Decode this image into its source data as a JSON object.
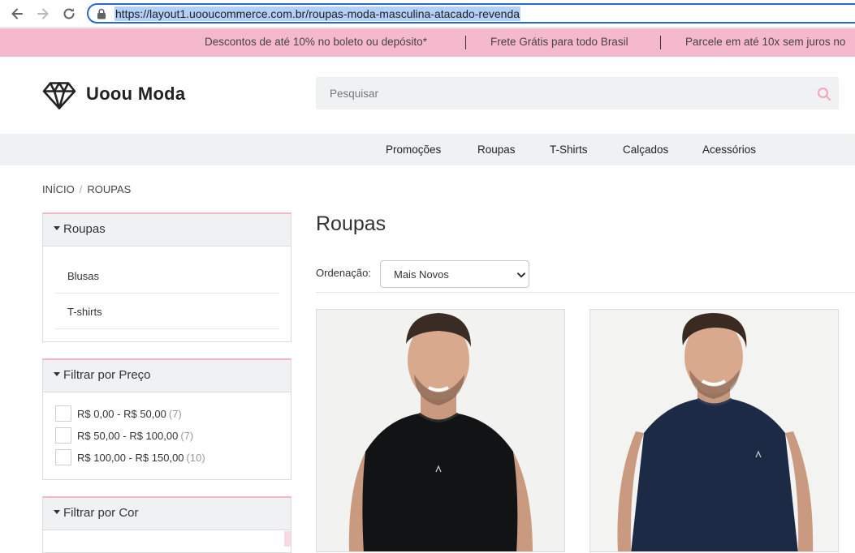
{
  "browser": {
    "url": "https://layout1.uooucommerce.com.br/roupas-moda-masculina-atacado-revenda"
  },
  "promo": {
    "items": [
      "Descontos de até 10% no boleto ou depósito*",
      "Frete Grátis para todo Brasil",
      "Parcele em até 10x sem juros no"
    ]
  },
  "header": {
    "brand": "Uoou Moda",
    "search_placeholder": "Pesquisar"
  },
  "nav": {
    "items": [
      "Promoções",
      "Roupas",
      "T-Shirts",
      "Calçados",
      "Acessórios"
    ]
  },
  "breadcrumb": {
    "home": "INÍCIO",
    "separator": "/",
    "current": "ROUPAS"
  },
  "sidebar": {
    "categories": {
      "title": "Roupas",
      "items": [
        "Blusas",
        "T-shirts"
      ]
    },
    "price_filter": {
      "title": "Filtrar por Preço",
      "options": [
        {
          "label": "R$ 0,00 - R$ 50,00",
          "count": "(7)"
        },
        {
          "label": "R$ 50,00 - R$ 100,00",
          "count": "(7)"
        },
        {
          "label": "R$ 100,00 - R$ 150,00",
          "count": "(10)"
        }
      ]
    },
    "color_filter": {
      "title": "Filtrar por Cor"
    }
  },
  "main": {
    "title": "Roupas",
    "sort_label": "Ordenação:",
    "sort_value": "Mais Novos"
  },
  "colors": {
    "promo_bg": "#f6b8cc",
    "accent_pink": "#f3b7c8",
    "nav_bg": "#f0f1f2",
    "url_border": "#2b67d6",
    "shirt_black": "#121314",
    "shirt_navy": "#1c2a45"
  }
}
